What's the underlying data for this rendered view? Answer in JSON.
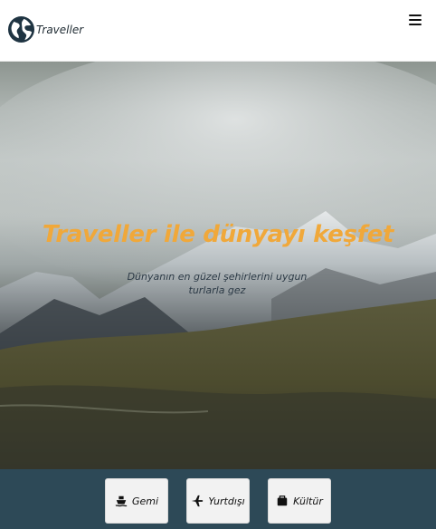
{
  "brand": {
    "name": "Traveller",
    "logo_icon": "globe-icon"
  },
  "menu": {
    "icon": "hamburger-menu-icon"
  },
  "hero": {
    "title": "Traveller ile dünyayı keşfet",
    "subtitle_line1": "Dünyanın en güzel şehirlerini uygun",
    "subtitle_line2": "turlarla gez",
    "image": "mountain-landscape"
  },
  "categories": [
    {
      "label": "Gemi",
      "icon": "ship-icon"
    },
    {
      "label": "Yurtdışı",
      "icon": "plane-icon"
    },
    {
      "label": "Kültür",
      "icon": "suitcase-icon"
    }
  ],
  "colors": {
    "accent": "#f0a83a",
    "footer_bar": "#2d4957",
    "button_bg": "#f2f2f2",
    "brand_text": "#1f2b33"
  }
}
